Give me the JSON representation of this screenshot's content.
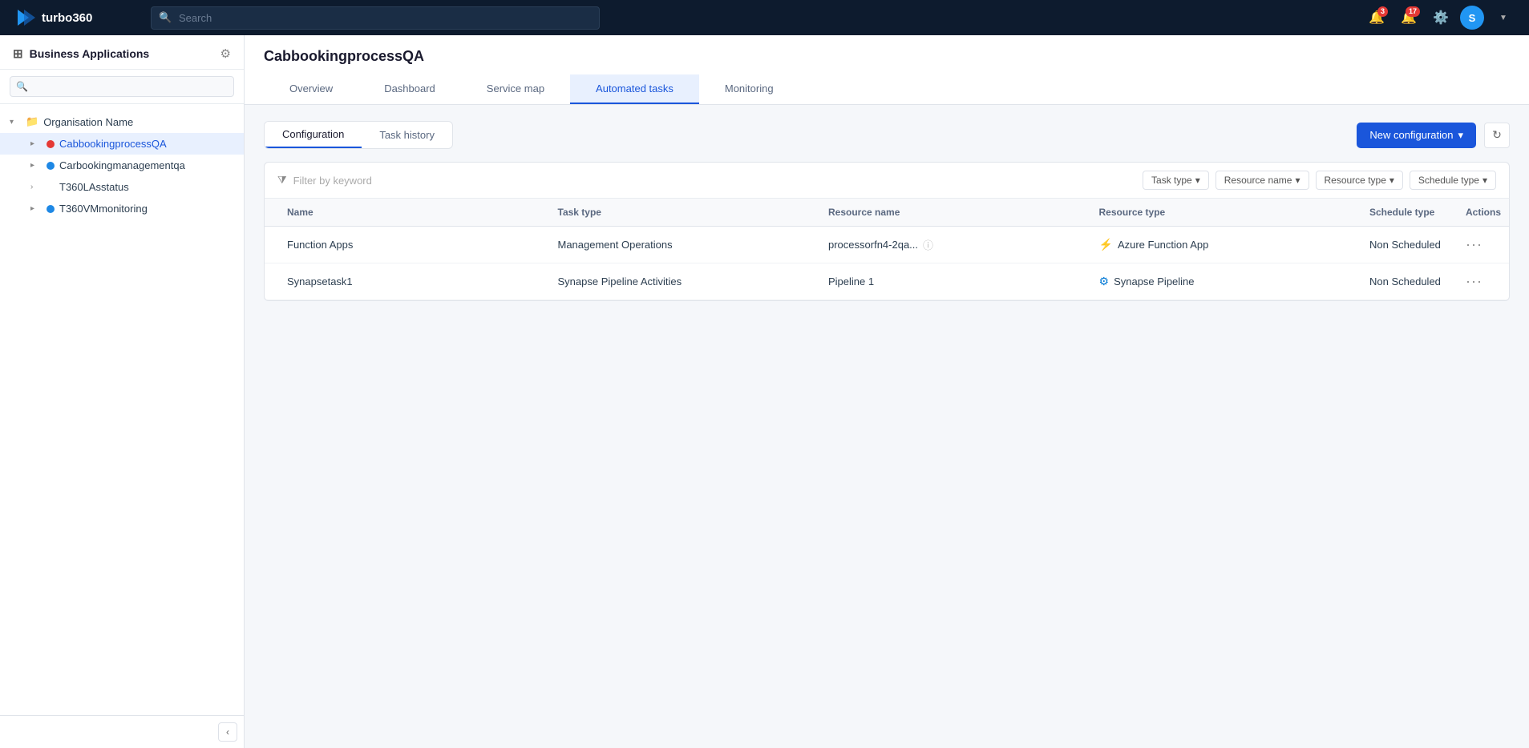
{
  "brand": {
    "name": "turbo360"
  },
  "nav": {
    "search_placeholder": "Search",
    "notifications_badge": "3",
    "alerts_badge": "17",
    "avatar_label": "S"
  },
  "sidebar": {
    "title": "Business Applications",
    "search_placeholder": "",
    "org": {
      "name": "Organisation Name"
    },
    "items": [
      {
        "id": "cabbookingprocessqa",
        "label": "CabbookingprocessQA",
        "dot": "red",
        "active": true,
        "indent": 1
      },
      {
        "id": "carbookingmanagementqa",
        "label": "Carbookingmanagementqa",
        "dot": "blue",
        "active": false,
        "indent": 1
      },
      {
        "id": "t360lasstatus",
        "label": "T360LAsstatus",
        "dot": null,
        "active": false,
        "indent": 1
      },
      {
        "id": "t360vmmonitoring",
        "label": "T360VMmonitoring",
        "dot": "blue",
        "active": false,
        "indent": 1
      }
    ]
  },
  "page": {
    "title": "CabbookingprocessQA",
    "tabs": [
      {
        "id": "overview",
        "label": "Overview"
      },
      {
        "id": "dashboard",
        "label": "Dashboard"
      },
      {
        "id": "service-map",
        "label": "Service map"
      },
      {
        "id": "automated-tasks",
        "label": "Automated tasks",
        "active": true
      },
      {
        "id": "monitoring",
        "label": "Monitoring"
      }
    ]
  },
  "automated_tasks": {
    "sub_tabs": [
      {
        "id": "configuration",
        "label": "Configuration",
        "active": true
      },
      {
        "id": "task-history",
        "label": "Task history"
      }
    ],
    "new_config_label": "New configuration",
    "filter_placeholder": "Filter by keyword",
    "filter_dropdowns": [
      {
        "id": "task-type",
        "label": "Task type"
      },
      {
        "id": "resource-name",
        "label": "Resource name"
      },
      {
        "id": "resource-type",
        "label": "Resource type"
      },
      {
        "id": "schedule-type",
        "label": "Schedule type"
      }
    ],
    "table": {
      "columns": [
        "Name",
        "Task type",
        "Resource name",
        "Resource type",
        "Schedule type",
        "Actions"
      ],
      "rows": [
        {
          "name": "Function Apps",
          "task_type": "Management Operations",
          "resource_name": "processorfn4-2qa...",
          "resource_type": "Azure Function App",
          "resource_icon": "⚡",
          "resource_icon_color": "azure",
          "schedule_type": "Non Scheduled"
        },
        {
          "name": "Synapsetask1",
          "task_type": "Synapse Pipeline Activities",
          "resource_name": "Pipeline 1",
          "resource_type": "Synapse Pipeline",
          "resource_icon": "⚙",
          "resource_icon_color": "synapse",
          "schedule_type": "Non Scheduled"
        }
      ]
    }
  }
}
